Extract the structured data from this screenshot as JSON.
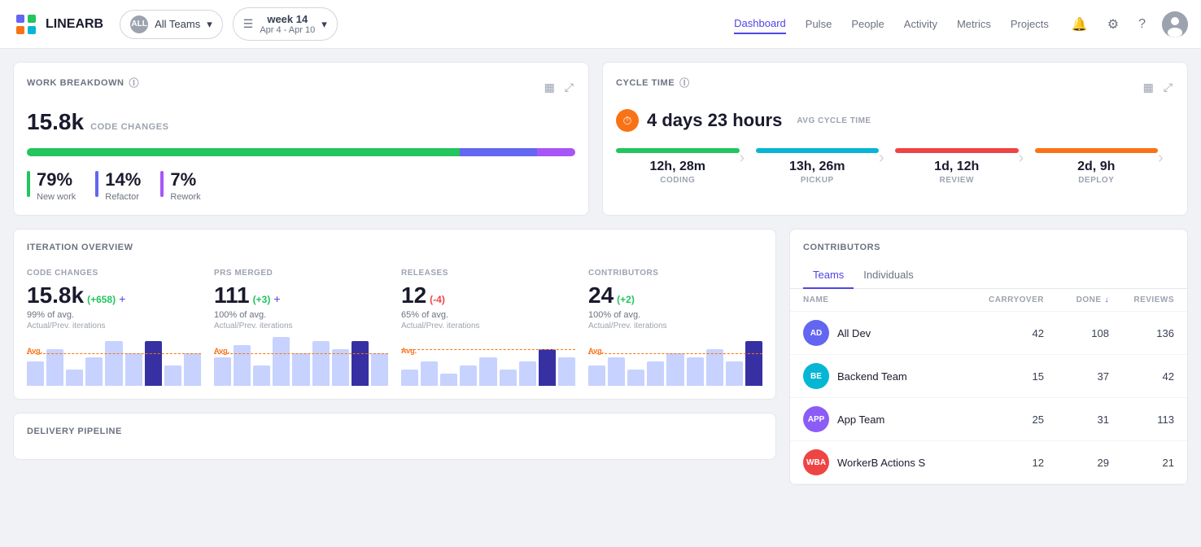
{
  "header": {
    "logo_text": "LINEARB",
    "all_teams_label": "All Teams",
    "all_badge": "ALL",
    "week_label": "week 14",
    "week_dates": "Apr 4 - Apr 10",
    "nav": [
      {
        "label": "Dashboard",
        "active": true
      },
      {
        "label": "Pulse",
        "active": false
      },
      {
        "label": "People",
        "active": false
      },
      {
        "label": "Activity",
        "active": false
      },
      {
        "label": "Metrics",
        "active": false
      },
      {
        "label": "Projects",
        "active": false
      }
    ]
  },
  "work_breakdown": {
    "title": "WORK BREAKDOWN",
    "value": "15.8k",
    "sub_label": "CODE CHANGES",
    "metrics": [
      {
        "pct": "79%",
        "label": "New work",
        "color": "#22c55e"
      },
      {
        "pct": "14%",
        "label": "Refactor",
        "color": "#6366f1"
      },
      {
        "pct": "7%",
        "label": "Rework",
        "color": "#a855f7"
      }
    ]
  },
  "cycle_time": {
    "title": "CYCLE TIME",
    "icon": "⏱",
    "value": "4 days 23 hours",
    "sub_label": "AVG CYCLE TIME",
    "stages": [
      {
        "label": "CODING",
        "value": "12h, 28m",
        "color": "#22c55e"
      },
      {
        "label": "PICKUP",
        "value": "13h, 26m",
        "color": "#06b6d4"
      },
      {
        "label": "REVIEW",
        "value": "1d, 12h",
        "color": "#ef4444"
      },
      {
        "label": "DEPLOY",
        "value": "2d, 9h",
        "color": "#f97316"
      }
    ]
  },
  "iteration_overview": {
    "title": "ITERATION OVERVIEW",
    "items": [
      {
        "label": "CODE CHANGES",
        "value": "15.8k",
        "delta": "(+658)",
        "delta_type": "pos",
        "avg": "99% of avg.",
        "sub": "Actual/Prev. iterations",
        "bars": [
          30,
          45,
          20,
          35,
          55,
          40,
          75,
          30,
          50
        ],
        "highlight": 6
      },
      {
        "label": "PRS MERGED",
        "value": "111",
        "delta": "(+3)",
        "delta_type": "pos",
        "avg": "100% of avg.",
        "sub": "Actual/Prev. iterations",
        "bars": [
          35,
          50,
          25,
          60,
          45,
          55,
          70,
          40,
          60
        ],
        "highlight": 7
      },
      {
        "label": "RELEASES",
        "value": "12",
        "delta": "(-4)",
        "delta_type": "neg",
        "avg": "65% of avg.",
        "sub": "Actual/Prev. iterations",
        "bars": [
          20,
          35,
          15,
          30,
          45,
          25,
          55,
          30,
          50
        ],
        "highlight": 7
      },
      {
        "label": "CONTRIBUTORS",
        "value": "24",
        "delta": "(+2)",
        "delta_type": "pos",
        "avg": "100% of avg.",
        "sub": "Actual/Prev. iterations",
        "bars": [
          25,
          40,
          20,
          35,
          50,
          40,
          60,
          35,
          70
        ],
        "highlight": 8
      }
    ]
  },
  "contributors": {
    "title": "CONTRIBUTORS",
    "tabs": [
      "Teams",
      "Individuals"
    ],
    "active_tab": "Teams",
    "columns": [
      "NAME",
      "CARRYOVER",
      "DONE",
      "REVIEWS"
    ],
    "rows": [
      {
        "name": "All Dev",
        "initials": "AD",
        "color": "#6366f1",
        "carryover": 42,
        "done": 108,
        "reviews": 136
      },
      {
        "name": "Backend Team",
        "initials": "BE",
        "color": "#06b6d4",
        "carryover": 15,
        "done": 37,
        "reviews": 42
      },
      {
        "name": "App Team",
        "initials": "APP",
        "color": "#8b5cf6",
        "carryover": 25,
        "done": 31,
        "reviews": 113
      },
      {
        "name": "WorkerB Actions S",
        "initials": "WBA",
        "color": "#ef4444",
        "carryover": 12,
        "done": 29,
        "reviews": 21
      }
    ]
  },
  "delivery_pipeline": {
    "title": "DELIVERY PIPELINE"
  },
  "icons": {
    "help": "?",
    "chart_bar": "▦",
    "expand": "⤢",
    "chevron_down": "▾",
    "calendar": "📅",
    "bell": "🔔",
    "gear": "⚙",
    "question": "?",
    "arrow_right": "›",
    "sort_down": "↓",
    "add": "+"
  }
}
